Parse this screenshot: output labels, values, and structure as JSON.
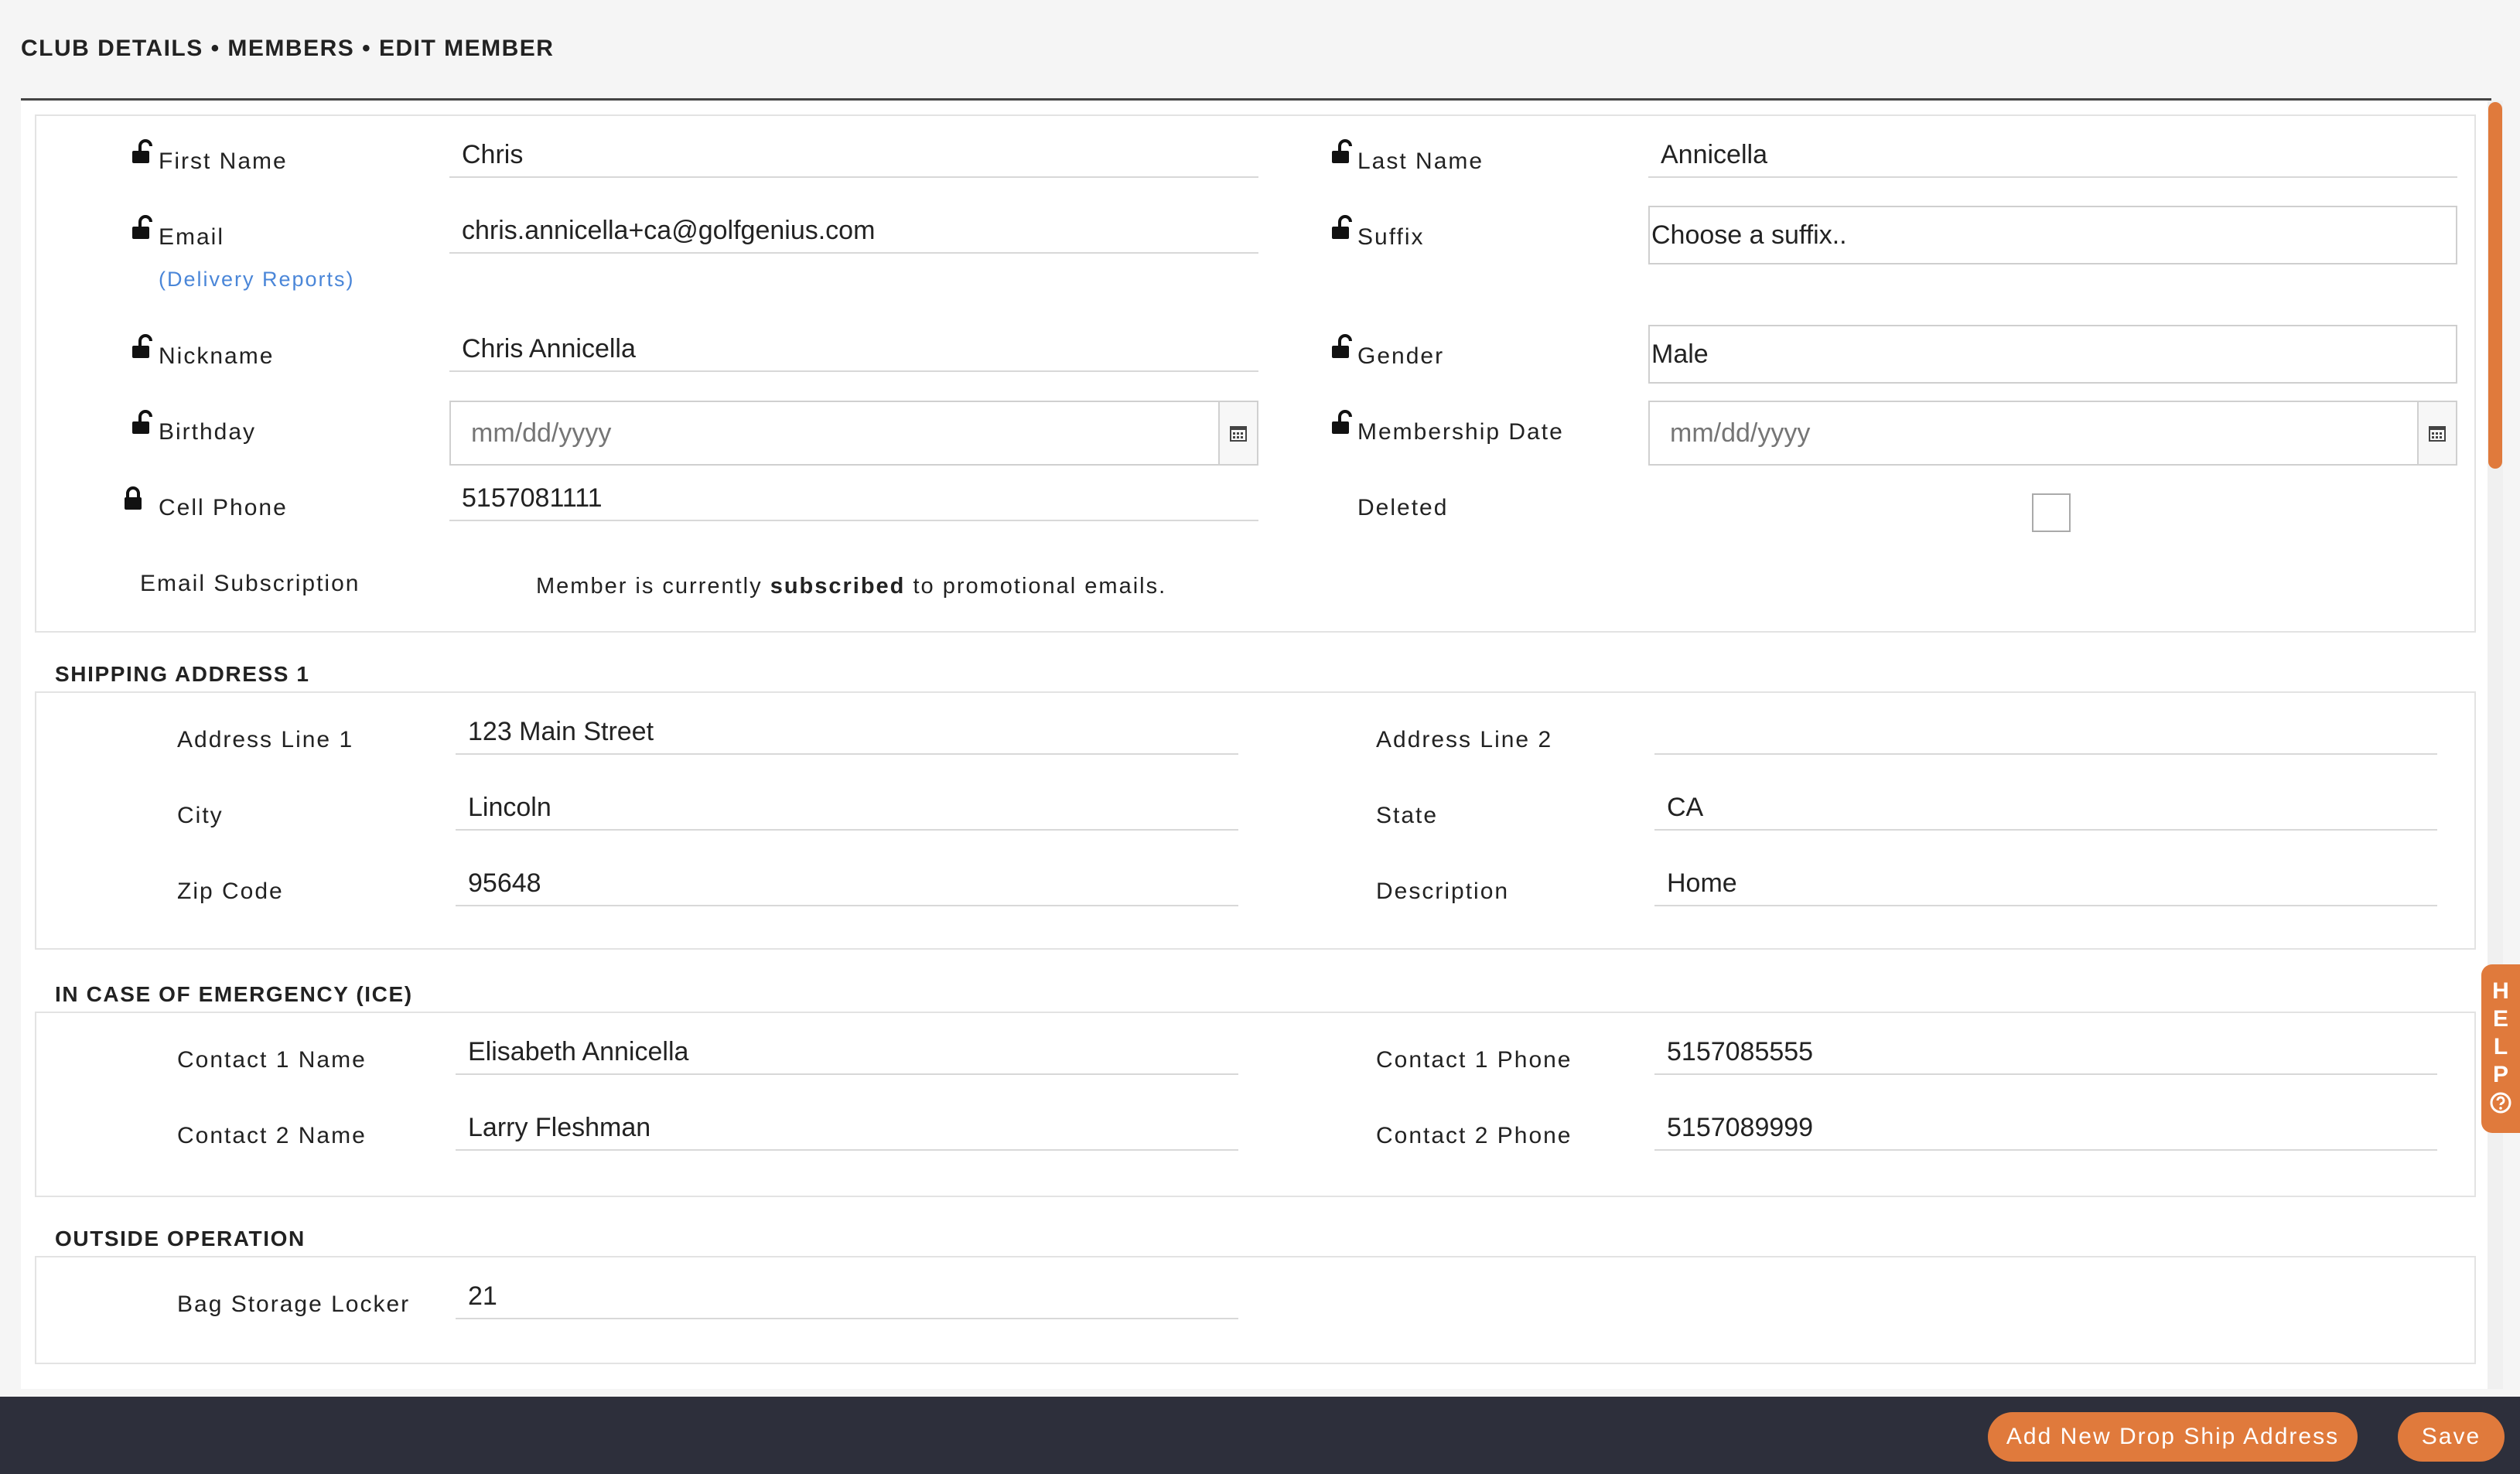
{
  "breadcrumb": "CLUB DETAILS • MEMBERS • EDIT MEMBER",
  "member": {
    "first_name_label": "First Name",
    "first_name": "Chris",
    "last_name_label": "Last Name",
    "last_name": "Annicella",
    "email_label": "Email",
    "email": "chris.annicella+ca@golfgenius.com",
    "delivery_reports_link": "(Delivery Reports)",
    "suffix_label": "Suffix",
    "suffix_placeholder": "Choose a suffix..",
    "nickname_label": "Nickname",
    "nickname": "Chris Annicella",
    "gender_label": "Gender",
    "gender": "Male",
    "birthday_label": "Birthday",
    "birthday_placeholder": "mm/dd/yyyy",
    "membership_date_label": "Membership Date",
    "membership_date_placeholder": "mm/dd/yyyy",
    "cell_phone_label": "Cell Phone",
    "cell_phone": "5157081111",
    "deleted_label": "Deleted",
    "deleted": false,
    "email_subscription_label": "Email Subscription",
    "email_subscription_pre": "Member is currently",
    "email_subscription_status": "subscribed",
    "email_subscription_post": "to promotional emails."
  },
  "shipping": {
    "title": "SHIPPING ADDRESS 1",
    "address_line1_label": "Address Line 1",
    "address_line1": "123 Main Street",
    "address_line2_label": "Address Line 2",
    "address_line2": "",
    "city_label": "City",
    "city": "Lincoln",
    "state_label": "State",
    "state": "CA",
    "zip_label": "Zip Code",
    "zip": "95648",
    "description_label": "Description",
    "description": "Home"
  },
  "emergency": {
    "title": "IN CASE OF EMERGENCY (ICE)",
    "contact1_name_label": "Contact 1 Name",
    "contact1_name": "Elisabeth Annicella",
    "contact1_phone_label": "Contact 1 Phone",
    "contact1_phone": "5157085555",
    "contact2_name_label": "Contact 2 Name",
    "contact2_name": "Larry Fleshman",
    "contact2_phone_label": "Contact 2 Phone",
    "contact2_phone": "5157089999"
  },
  "outside": {
    "title": "OUTSIDE OPERATION",
    "bag_locker_label": "Bag Storage Locker",
    "bag_locker": "21"
  },
  "help": {
    "letters": [
      "H",
      "E",
      "L",
      "P"
    ],
    "icon": "question-circle-icon"
  },
  "footer": {
    "add_drop_ship_label": "Add New Drop Ship Address",
    "save_label": "Save"
  },
  "colors": {
    "accent": "#e07a3c",
    "footer_bg": "#2d2f3b",
    "link": "#4a86d8"
  },
  "icons": {
    "unlocked": "unlocked-padlock-icon",
    "locked": "locked-padlock-icon",
    "calendar": "calendar-icon"
  }
}
